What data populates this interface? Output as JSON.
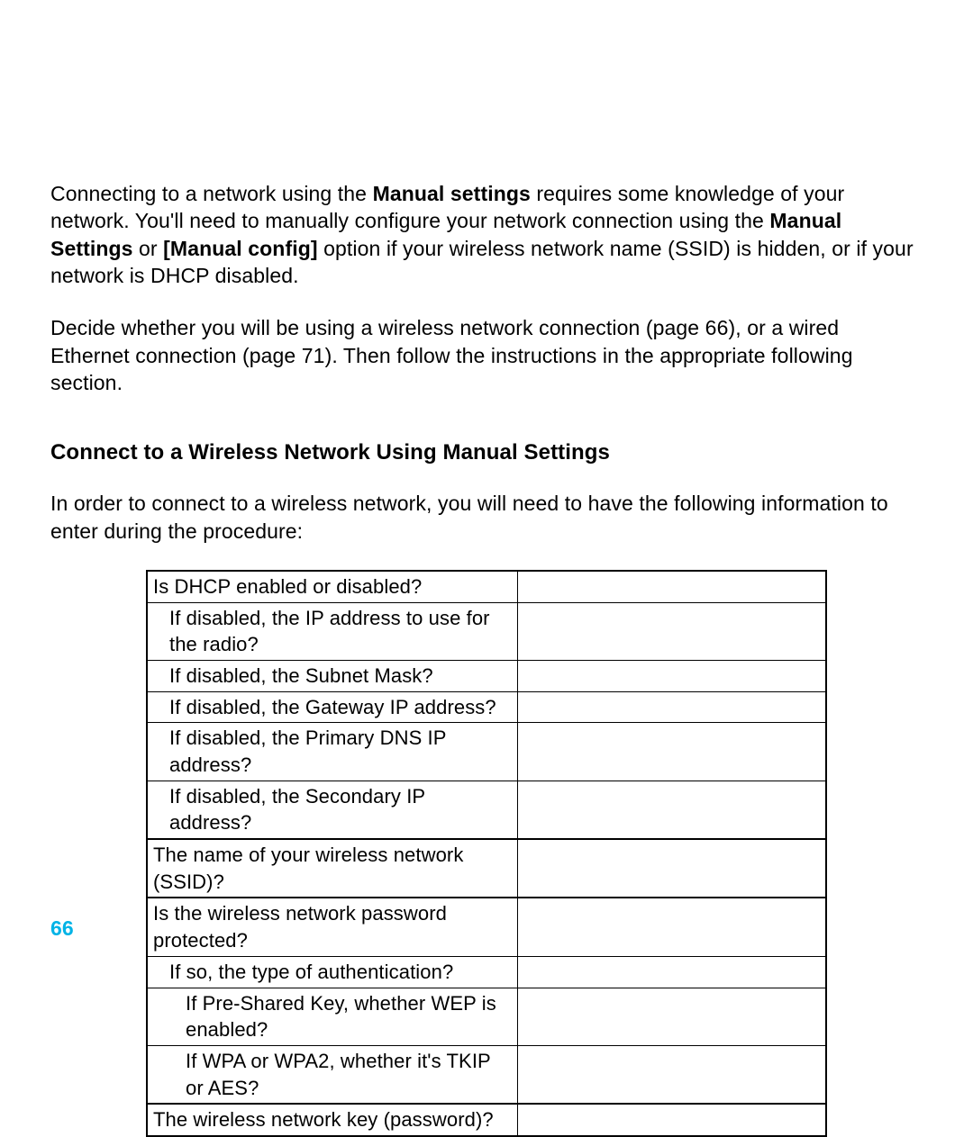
{
  "para1": {
    "seg1": "Connecting to a network using the ",
    "bold1": "Manual settings",
    "seg2": " requires some knowledge of your network. You'll need to manually configure your network connection using the ",
    "bold2": "Manual Settings",
    "seg3": " or ",
    "bold3": "[Manual config]",
    "seg4": " option if your wireless network name (SSID) is hidden, or if your network is DHCP disabled."
  },
  "para2": "Decide whether you will be using a wireless network connection (page 66), or a wired Ethernet connection (page 71). Then follow the instructions in the appropriate following section.",
  "heading": "Connect to a Wireless Network Using Manual Settings",
  "para3": "In order to connect to a wireless network, you will need to have the following information to enter during the procedure:",
  "table": {
    "rows": [
      {
        "q": "Is DHCP enabled or disabled?",
        "indent": 0,
        "group_top": true
      },
      {
        "q": "If disabled, the IP address to use for the radio?",
        "indent": 1
      },
      {
        "q": "If disabled, the Subnet Mask?",
        "indent": 1
      },
      {
        "q": "If disabled, the Gateway IP address?",
        "indent": 1
      },
      {
        "q": "If disabled, the Primary DNS IP address?",
        "indent": 1
      },
      {
        "q": "If disabled, the Secondary IP address?",
        "indent": 1
      },
      {
        "q": "The name of your wireless network (SSID)?",
        "indent": 0,
        "group_top": true
      },
      {
        "q": "Is the wireless network password protected?",
        "indent": 0,
        "group_top": true
      },
      {
        "q": "If so, the type of authentication?",
        "indent": 1
      },
      {
        "q": "If Pre-Shared Key, whether WEP is enabled?",
        "indent": 2
      },
      {
        "q": "If WPA or WPA2, whether it's TKIP or AES?",
        "indent": 2
      },
      {
        "q": "The wireless network key (password)?",
        "indent": 0,
        "group_top": true
      }
    ]
  },
  "page_number": "66"
}
